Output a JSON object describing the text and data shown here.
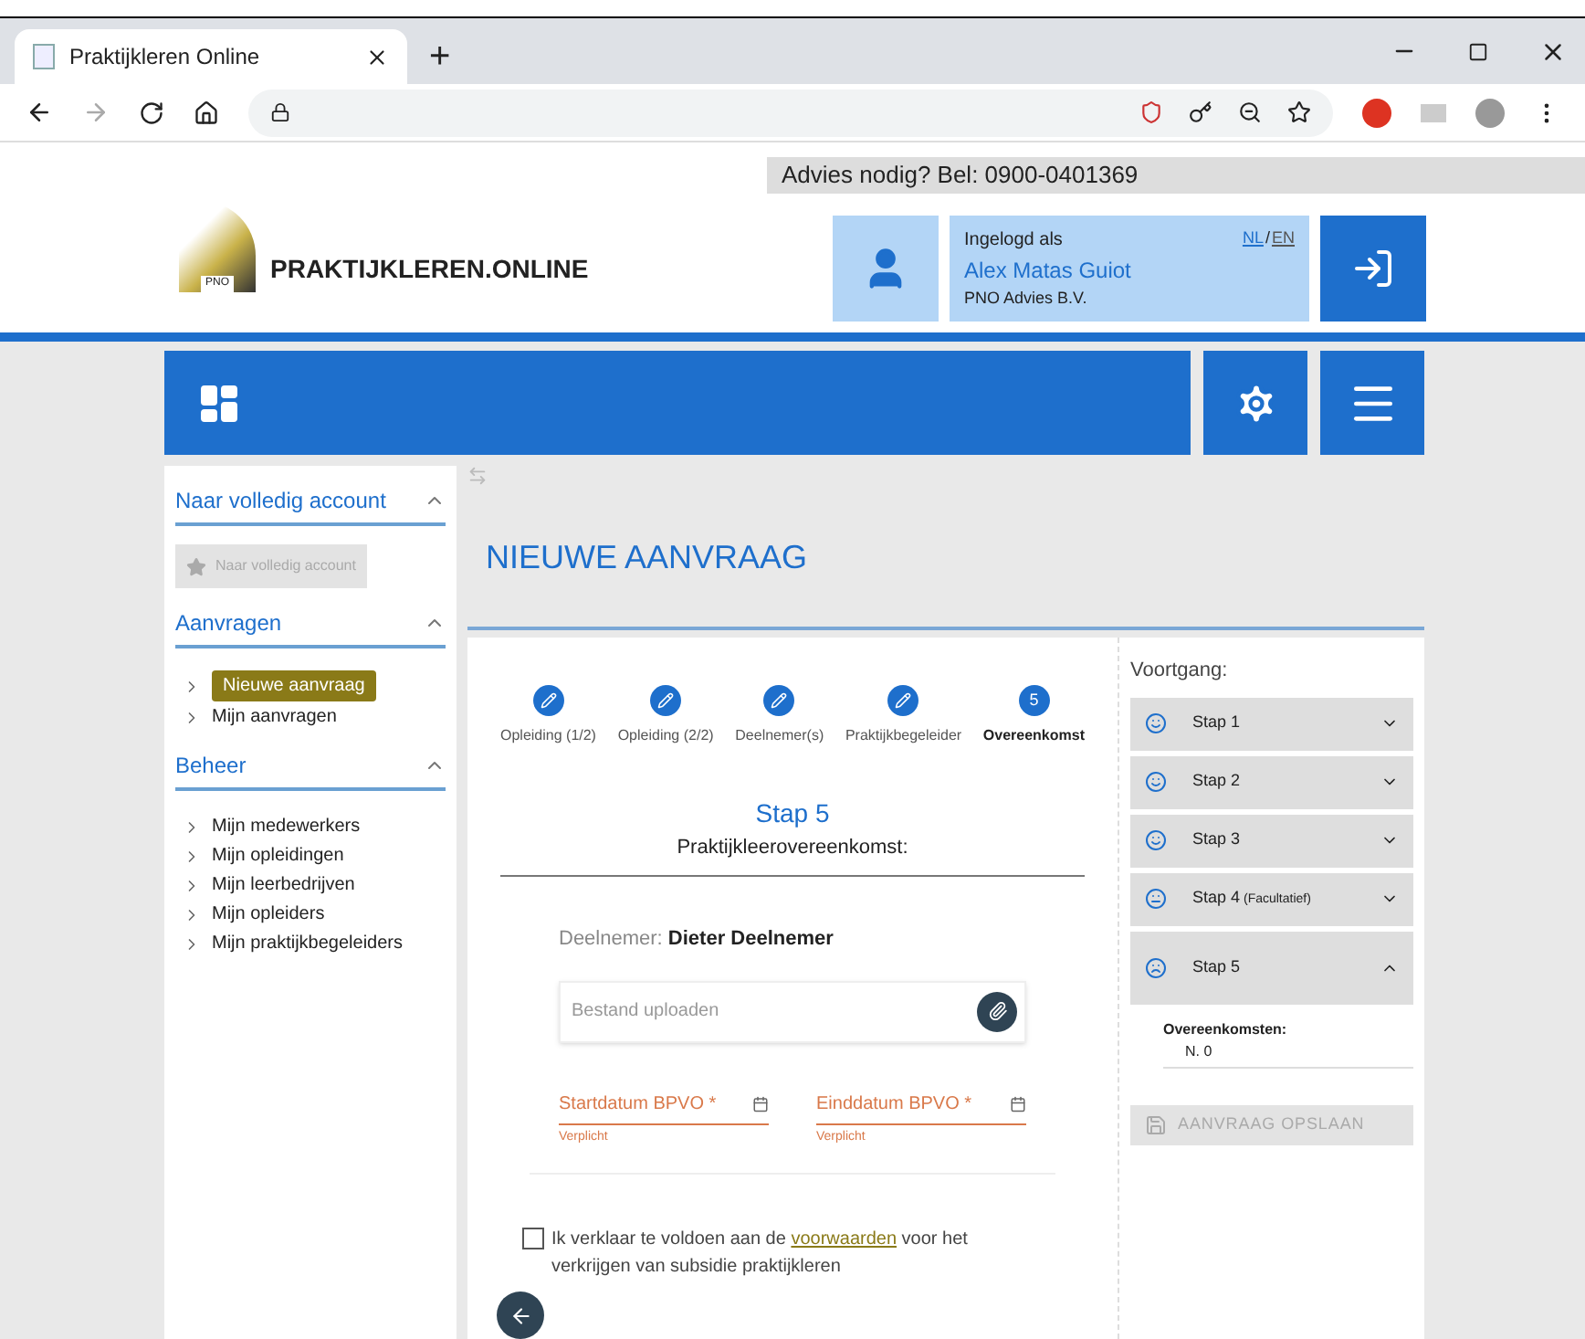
{
  "browser": {
    "tab_title": "Praktijkleren Online",
    "new_tab": "+"
  },
  "header": {
    "advice": "Advies nodig? Bel: 0900-0401369",
    "logo_small": "PNO",
    "brand": "PRAKTIJKLEREN.ONLINE",
    "logged_in_label": "Ingelogd als",
    "user_name": "Alex Matas Guiot",
    "company": "PNO Advies B.V.",
    "languages": [
      {
        "label": "NL",
        "selected": true
      },
      {
        "label": "EN",
        "selected": false
      }
    ],
    "separator": "/"
  },
  "sidebar": {
    "sections": [
      {
        "title": "Naar volledig account",
        "expanded": true,
        "button": {
          "label": "Naar volledig account",
          "disabled": true
        }
      },
      {
        "title": "Aanvragen",
        "expanded": true,
        "items": [
          {
            "label": "Nieuwe aanvraag",
            "selected": true
          },
          {
            "label": "Mijn aanvragen",
            "selected": false
          }
        ]
      },
      {
        "title": "Beheer",
        "expanded": true,
        "items": [
          {
            "label": "Mijn medewerkers",
            "selected": false
          },
          {
            "label": "Mijn opleidingen",
            "selected": false
          },
          {
            "label": "Mijn leerbedrijven",
            "selected": false
          },
          {
            "label": "Mijn opleiders",
            "selected": false
          },
          {
            "label": "Mijn praktijkbegeleiders",
            "selected": false
          }
        ]
      }
    ]
  },
  "page_title": "NIEUWE AANVRAAG",
  "stepper": [
    {
      "label": "Opleiding (1/2)",
      "kind": "done"
    },
    {
      "label": "Opleiding (2/2)",
      "kind": "done"
    },
    {
      "label": "Deelnemer(s)",
      "kind": "done"
    },
    {
      "label": "Praktijkbegeleider",
      "kind": "done"
    },
    {
      "label": "Overeenkomst",
      "kind": "current",
      "number": "5"
    }
  ],
  "form": {
    "step_title": "Stap 5",
    "step_subtitle": "Praktijkleerovereenkomst:",
    "participant_label": "Deelnemer:",
    "participant": "Dieter Deelnemer",
    "upload_placeholder": "Bestand uploaden",
    "dates": [
      {
        "label": "Startdatum BPVO *",
        "error": "Verplicht"
      },
      {
        "label": "Einddatum BPVO *",
        "error": "Verplicht"
      }
    ],
    "agreement": {
      "checked": false,
      "before": "Ik verklaar te voldoen aan de",
      "link": "voorwaarden",
      "after": "voor het verkrijgen van subsidie praktijkleren"
    }
  },
  "progress": {
    "title": "Voortgang:",
    "steps": [
      {
        "label": "Stap 1",
        "kind": "happy",
        "expanded": false
      },
      {
        "label": "Stap 2",
        "kind": "happy",
        "expanded": false
      },
      {
        "label": "Stap 3",
        "kind": "happy",
        "expanded": false
      },
      {
        "label": "Stap 4",
        "note": "(Facultatief)",
        "kind": "neutral",
        "expanded": false
      },
      {
        "label": "Stap 5",
        "kind": "sad",
        "expanded": true,
        "detail_label": "Overeenkomsten:",
        "detail_value": "N. 0"
      }
    ],
    "save": {
      "label": "AANVRAAG OPSLAAN",
      "disabled": true
    }
  }
}
